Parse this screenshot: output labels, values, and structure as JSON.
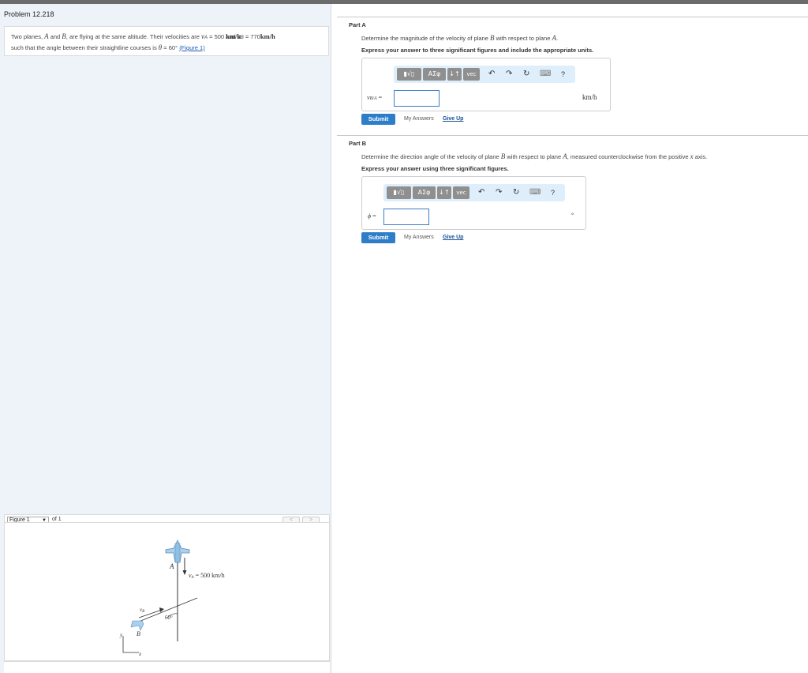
{
  "problem": {
    "title": "Problem 12.218",
    "text_intro": "Two planes, ",
    "plane_a": "A",
    "and_text": " and ",
    "plane_b": "B",
    "text_mid": ", are flying at the same altitude. Their velocities are ",
    "va_sym": "v",
    "va_sub": "A",
    "va_value": " = 500 ",
    "unit_kmh": "km/h",
    "and2": " and ",
    "vb_sym": "v",
    "vb_sub": "B",
    "vb_value": " = 770 ",
    "line2": "such that the angle between their straightline courses is ",
    "theta": "θ",
    "theta_value": " = 60°",
    "figure_link": "(Figure 1)"
  },
  "figure_nav": {
    "select_value": "Figure 1",
    "of_text": "of 1",
    "prev": "<",
    "next": ">"
  },
  "figure": {
    "label_a": "A",
    "label_b": "B",
    "va_label": "v",
    "va_sub": "A",
    "va_text": " = 500 km/h",
    "vb_label": "v",
    "vb_sub": "B",
    "angle": "60°",
    "axis_y": "y",
    "axis_x": "x"
  },
  "part_a": {
    "label": "Part A",
    "instr_pre": "Determine the magnitude of the velocity of plane ",
    "instr_b": "B",
    "instr_mid": " with respect to plane ",
    "instr_a": "A",
    "instr_end": ".",
    "bold_instr": "Express your answer to three significant figures and include the appropriate units.",
    "var_label": "v",
    "var_sub": "B/A",
    "equals": " =",
    "unit": "km/h",
    "submit": "Submit",
    "my_answers": "My Answers",
    "give_up": "Give Up"
  },
  "part_b": {
    "label": "Part B",
    "instr_pre": "Determine the direction angle of the velocity of plane ",
    "instr_b": "B",
    "instr_mid": " with respect to plane ",
    "instr_a": "A",
    "instr_end": ", measured counterclockwise from the positive ",
    "instr_x": "x",
    "instr_tail": " axis.",
    "bold_instr": "Express your answer using three significant figures.",
    "var_label": "ϕ",
    "equals": " =",
    "unit": "°",
    "submit": "Submit",
    "my_answers": "My Answers",
    "give_up": "Give Up"
  },
  "toolbar": {
    "template_btn": "▮√▯",
    "greek_btn": "ΑΣφ",
    "arrows_btn": "↓↑",
    "vec_btn": "vec",
    "undo": "↶",
    "redo": "↷",
    "reset": "↻",
    "keyboard": "⌨",
    "help": "?"
  },
  "colors": {
    "accent": "#2e7dc8",
    "panel_bg": "#eef3fa",
    "toolbar_bg": "#dfeefb"
  }
}
